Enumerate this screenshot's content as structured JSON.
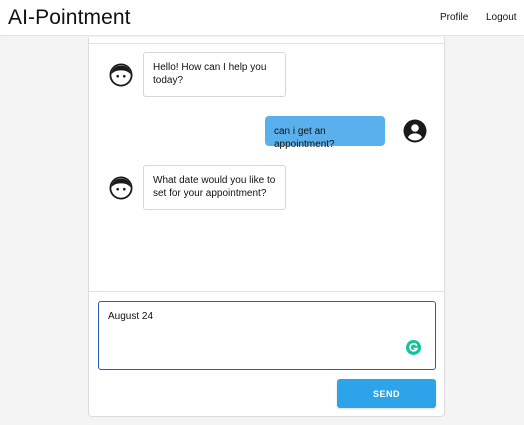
{
  "app": {
    "title": "AI-Pointment",
    "nav": {
      "profile": "Profile",
      "logout": "Logout"
    }
  },
  "chat": {
    "messages": [
      {
        "sender": "bot",
        "avatar_icon": "bot-face-icon",
        "text": "Hello! How can I help you today?"
      },
      {
        "sender": "user",
        "avatar_icon": "user-account-icon",
        "text": "can i get an appointment?"
      },
      {
        "sender": "bot",
        "avatar_icon": "bot-face-icon",
        "text": "What date would you like to set for your appointment?"
      }
    ],
    "input": {
      "value": "August 24",
      "assist_icon": "grammarly-icon"
    },
    "send_label": "SEND"
  },
  "colors": {
    "user_bubble": "#5ab0ec",
    "send_button": "#2da3ea",
    "input_border": "#2a5bc0",
    "page_background": "#f4f4f4"
  }
}
